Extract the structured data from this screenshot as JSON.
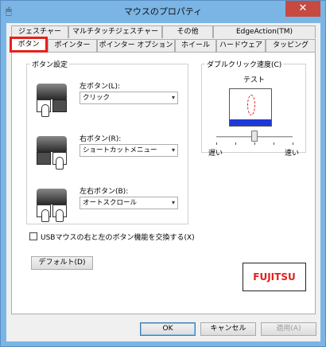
{
  "window": {
    "title": "マウスのプロパティ",
    "close_glyph": "✕"
  },
  "tabs_row1": [
    {
      "label": "ジェスチャー"
    },
    {
      "label": "マルチタッチジェスチャー"
    },
    {
      "label": "その他"
    },
    {
      "label": "EdgeAction(TM)"
    }
  ],
  "tabs_row2": [
    {
      "label": "ボタン",
      "active": true
    },
    {
      "label": "ポインター"
    },
    {
      "label": "ポインター オプション"
    },
    {
      "label": "ホイール"
    },
    {
      "label": "ハードウェア"
    },
    {
      "label": "タッピング"
    }
  ],
  "button_settings": {
    "legend": "ボタン設定",
    "left": {
      "label": "左ボタン(L):",
      "value": "クリック"
    },
    "right": {
      "label": "右ボタン(R):",
      "value": "ショートカットメニュー"
    },
    "both": {
      "label": "左右ボタン(B):",
      "value": "オートスクロール"
    }
  },
  "double_click": {
    "legend": "ダブルクリック速度(C)",
    "test_label": "テスト",
    "slow_label": "遅い",
    "fast_label": "速い",
    "speed_percent": 50
  },
  "swap_checkbox": {
    "label": "USBマウスの右と左のボタン機能を交換する(X)",
    "checked": false
  },
  "default_button": "デフォルト(D)",
  "logo_text": "FUJITSU",
  "footer": {
    "ok": "OK",
    "cancel": "キャンセル",
    "apply": "適用(A)"
  },
  "colors": {
    "accent_red": "#e8201a",
    "title_bar": "#7bb5e5",
    "test_floor": "#1f39d6"
  }
}
